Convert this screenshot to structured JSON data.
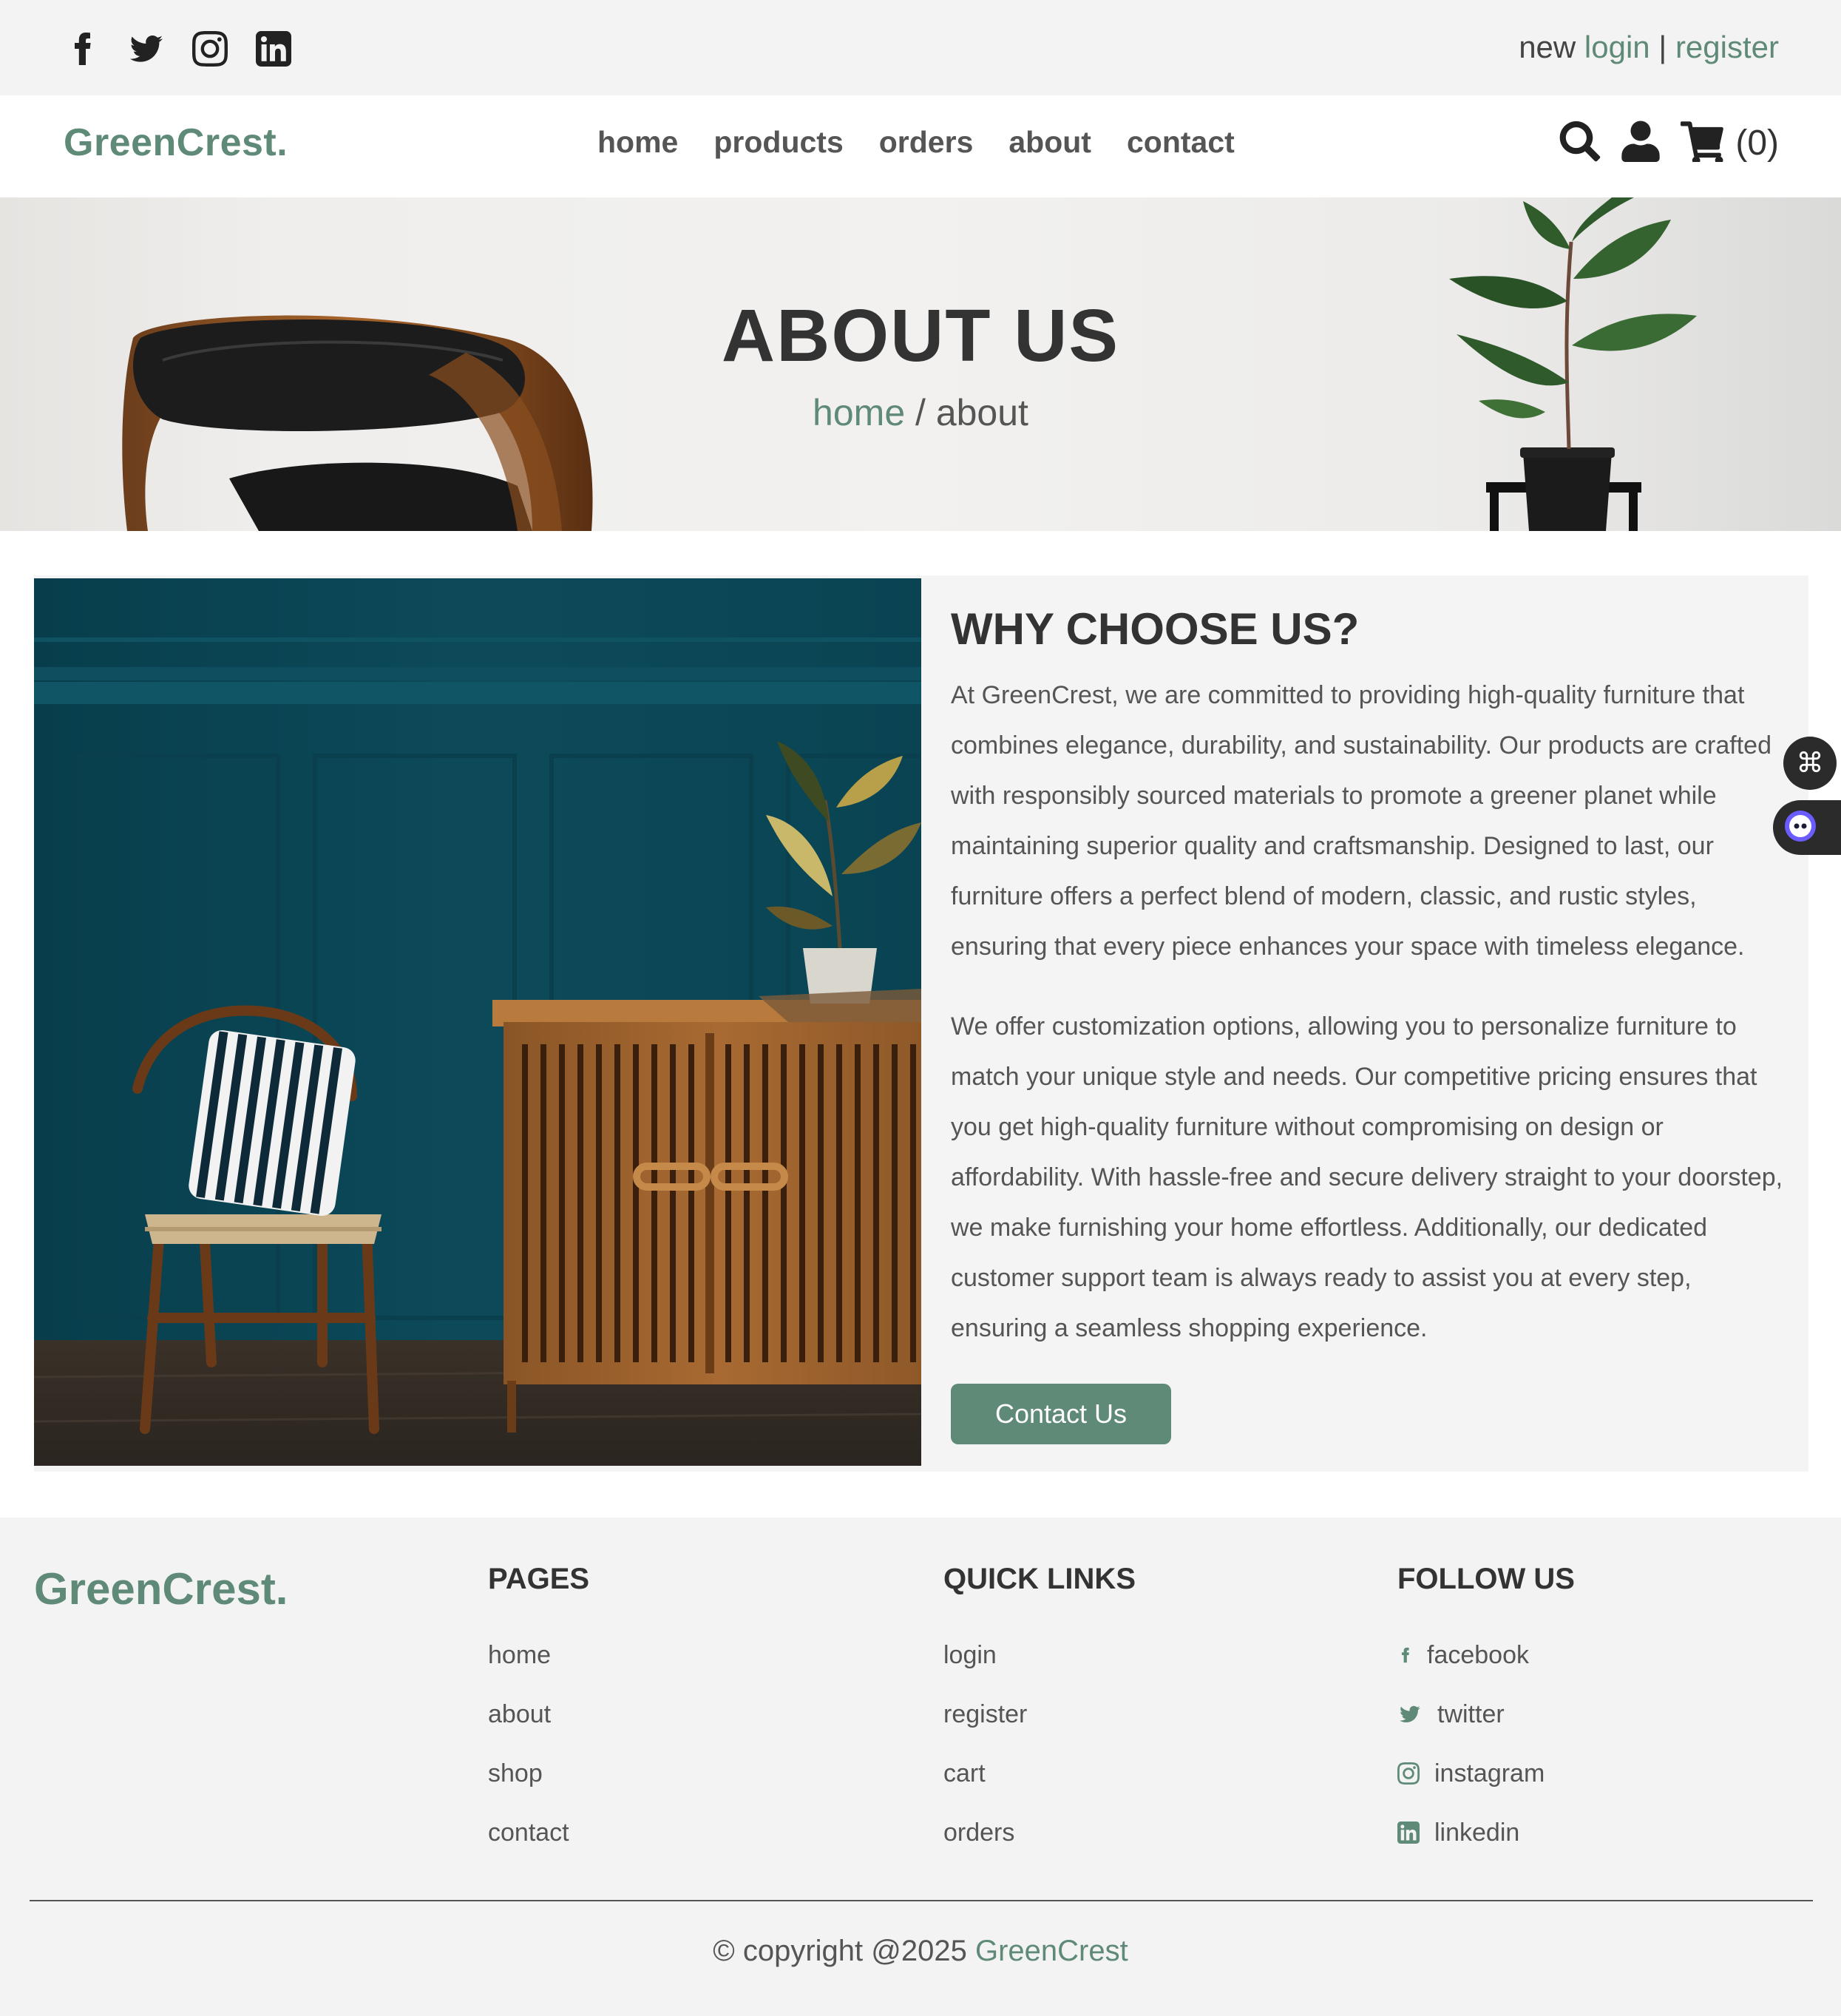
{
  "topbar": {
    "social_icons": [
      "facebook-icon",
      "twitter-icon",
      "instagram-icon",
      "linkedin-icon"
    ],
    "auth_prefix": "new",
    "login_label": "login",
    "separator": "|",
    "register_label": "register"
  },
  "header": {
    "logo": "GreenCrest.",
    "nav": [
      "home",
      "products",
      "orders",
      "about",
      "contact"
    ],
    "icons": [
      "search-icon",
      "user-icon",
      "cart-icon"
    ],
    "cart_count": "(0)"
  },
  "banner": {
    "title": "ABOUT US",
    "crumb_home": "home",
    "crumb_sep": " / ",
    "crumb_current": "about"
  },
  "about": {
    "title": "WHY CHOOSE US?",
    "paragraph1": "At GreenCrest, we are committed to providing high-quality furniture that combines elegance, durability, and sustainability. Our products are crafted with responsibly sourced materials to promote a greener planet while maintaining superior quality and craftsmanship. Designed to last, our furniture offers a perfect blend of modern, classic, and rustic styles, ensuring that every piece enhances your space with timeless elegance.",
    "paragraph2": "We offer customization options, allowing you to personalize furniture to match your unique style and needs. Our competitive pricing ensures that you get high-quality furniture without compromising on design or affordability. With hassle-free and secure delivery straight to your doorstep, we make furnishing your home effortless. Additionally, our dedicated customer support team is always ready to assist you at every step, ensuring a seamless shopping experience.",
    "cta_label": "Contact Us"
  },
  "footer": {
    "logo": "GreenCrest.",
    "pages": {
      "title": "PAGES",
      "items": [
        "home",
        "about",
        "shop",
        "contact"
      ]
    },
    "quick": {
      "title": "QUICK LINKS",
      "items": [
        "login",
        "register",
        "cart",
        "orders"
      ]
    },
    "follow": {
      "title": "FOLLOW US",
      "items": [
        "facebook",
        "twitter",
        "instagram",
        "linkedin"
      ],
      "icons": [
        "facebook-icon",
        "twitter-icon",
        "instagram-icon",
        "linkedin-icon"
      ]
    },
    "copyright_prefix": "© copyright @2025",
    "copyright_brand": "GreenCrest"
  },
  "colors": {
    "accent": "#5e8a77",
    "bar_bg": "#f3f3f3",
    "text_dark": "#333333",
    "text_muted": "#555555",
    "teal_wall": "#0b4a5a"
  }
}
